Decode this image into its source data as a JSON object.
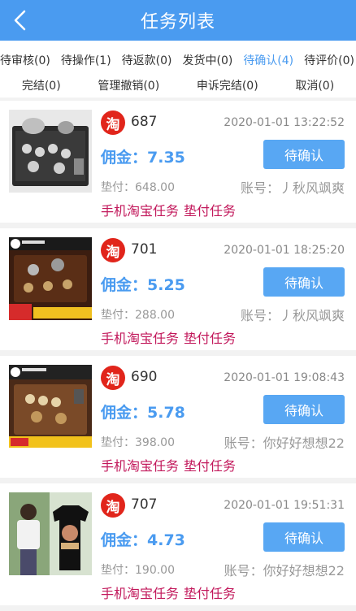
{
  "header": {
    "title": "任务列表"
  },
  "tabs_row1": [
    {
      "label": "待审核(0)",
      "active": false
    },
    {
      "label": "待操作(1)",
      "active": false
    },
    {
      "label": "待返款(0)",
      "active": false
    },
    {
      "label": "发货中(0)",
      "active": false
    },
    {
      "label": "待确认(4)",
      "active": true
    },
    {
      "label": "待评价(0)",
      "active": false
    }
  ],
  "tabs_row2": [
    {
      "label": "完结(0)"
    },
    {
      "label": "管理撤销(0)"
    },
    {
      "label": "申诉完结(0)"
    },
    {
      "label": "取消(0)"
    }
  ],
  "shop_icon_char": "淘",
  "orders": [
    {
      "id": "687",
      "time": "2020-01-01 13:22:52",
      "commission": "佣金：7.35",
      "advance": "垫付：648.00",
      "account": "账号：丿秋风飒爽",
      "button": "待确认",
      "tag1": "手机淘宝任务",
      "tag2": "垫付任务",
      "image": "tea-set-black"
    },
    {
      "id": "701",
      "time": "2020-01-01 18:25:20",
      "commission": "佣金：5.25",
      "advance": "垫付：288.00",
      "account": "账号：丿秋风飒爽",
      "button": "待确认",
      "tag1": "手机淘宝任务",
      "tag2": "垫付任务",
      "image": "tea-set-promo"
    },
    {
      "id": "690",
      "time": "2020-01-01 19:08:43",
      "commission": "佣金：5.78",
      "advance": "垫付：398.00",
      "account": "账号：你好好想想22",
      "button": "待确认",
      "tag1": "手机淘宝任务",
      "tag2": "垫付任务",
      "image": "tea-tray-wood"
    },
    {
      "id": "707",
      "time": "2020-01-01 19:51:31",
      "commission": "佣金：4.73",
      "advance": "垫付：190.00",
      "account": "账号：你好好想想22",
      "button": "待确认",
      "tag1": "手机淘宝任务",
      "tag2": "垫付任务",
      "image": "tshirt-model"
    }
  ],
  "colors": {
    "header": "#4a9bf0",
    "accent": "#4a9bf0",
    "tag": "#c2185b",
    "taobao": "#e1251b"
  }
}
